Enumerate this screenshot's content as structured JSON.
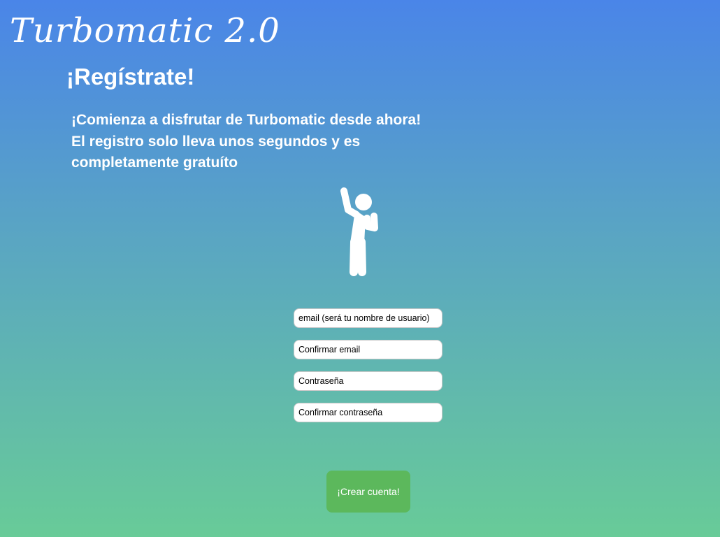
{
  "app": {
    "title": "Turbomatic 2.0"
  },
  "page": {
    "heading": "¡Regístrate!",
    "intro": "¡Comienza a disfrutar de Turbomatic desde ahora! El registro solo lleva unos segundos y es completamente gratuíto"
  },
  "figure": {
    "icon": "cheering-person-icon"
  },
  "form": {
    "fields": [
      {
        "placeholder": "email (será tu nombre de usuario)",
        "type": "email"
      },
      {
        "placeholder": "Confirmar email",
        "type": "email"
      },
      {
        "placeholder": "Contraseña",
        "type": "password"
      },
      {
        "placeholder": "Confirmar contraseña",
        "type": "password"
      }
    ],
    "submit_label": "¡Crear cuenta!"
  },
  "colors": {
    "gradient_top": "#4a85e8",
    "gradient_bottom": "#68cb98",
    "button": "#5cb85c",
    "text": "#ffffff"
  }
}
